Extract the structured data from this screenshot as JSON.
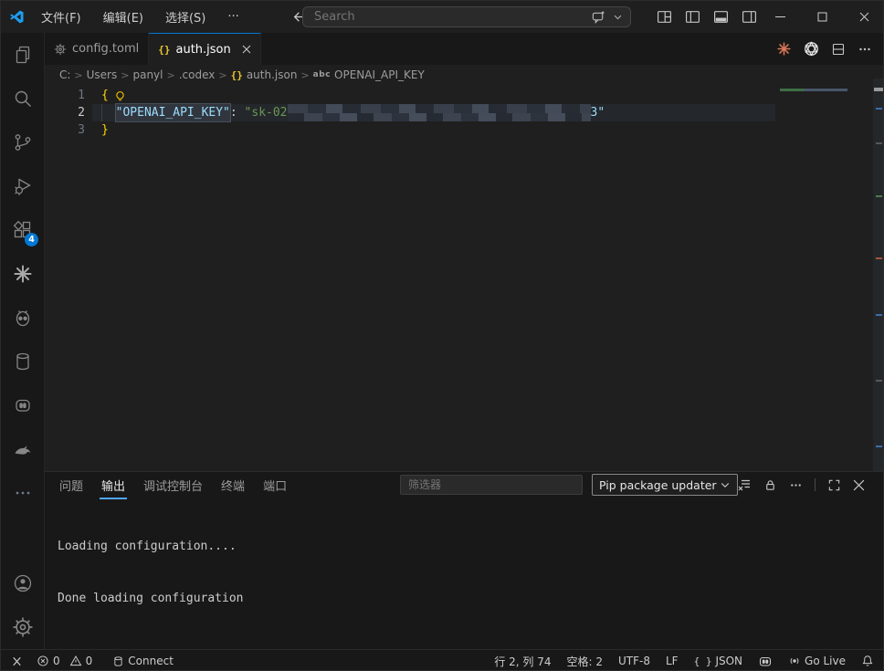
{
  "titlebar": {
    "menus": [
      "文件(F)",
      "编辑(E)",
      "选择(S)",
      "···"
    ],
    "search_placeholder": "Search"
  },
  "tabs": {
    "tab1_label": "config.toml",
    "tab2_label": "auth.json"
  },
  "breadcrumb": {
    "items": [
      "C:",
      "Users",
      "panyl",
      ".codex",
      "auth.json",
      "OPENAI_API_KEY"
    ],
    "abc_symbol": "abc"
  },
  "editor": {
    "line_numbers": [
      "1",
      "2",
      "3"
    ],
    "line1_text": "{",
    "line2_indent": "  ",
    "line2_key": "\"OPENAI_API_KEY\"",
    "line2_colon": ": ",
    "line2_value_start": "\"sk-02",
    "line2_value_end": "3\"",
    "line3_text": "}"
  },
  "activity_bar": {
    "extensions_badge": "4"
  },
  "panel": {
    "tabs": [
      "问题",
      "输出",
      "调试控制台",
      "终端",
      "端口"
    ],
    "active_tab": "输出",
    "filter_placeholder": "筛选器",
    "channel_selected": "Pip package updater",
    "output_lines": [
      "Loading configuration....",
      "Done loading configuration"
    ]
  },
  "status_bar": {
    "errors": "0",
    "warnings": "0",
    "connect_label": "Connect",
    "cursor_position": "行 2, 列 74",
    "indentation": "空格: 2",
    "encoding": "UTF-8",
    "eol": "LF",
    "language": "JSON",
    "go_live_label": "Go Live"
  },
  "colors": {
    "accent_blue": "#0078d4",
    "panel_tab_underline": "#4da6ff",
    "brace_yellow": "#ffd602",
    "json_key_blue": "#9cdcfe",
    "string_green": "#6a9955",
    "claude_orange": "#d97757",
    "badge_blue": "#0078d4",
    "editor_background": "#1f1f1f",
    "shell_background": "#181818"
  }
}
